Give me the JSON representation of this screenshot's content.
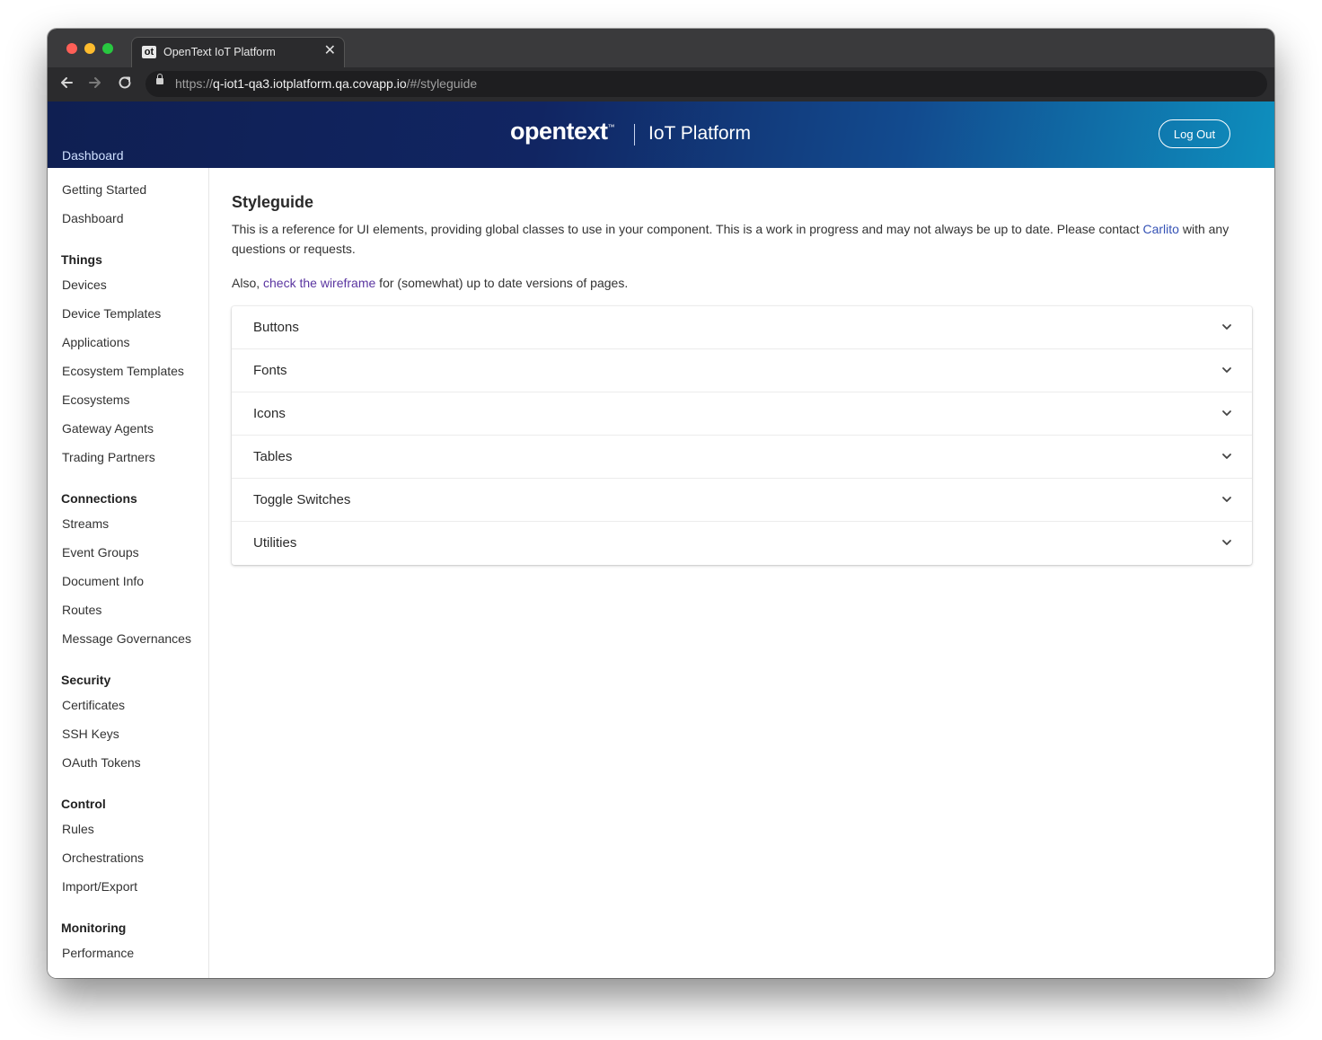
{
  "browser": {
    "tab_title": "OpenText IoT Platform",
    "tab_favicon": "ot",
    "tab_close": "✕",
    "url_scheme": "https://",
    "url_host": "q-iot1-qa3.iotplatform.qa.covapp.io",
    "url_path": "/#/styleguide",
    "icons": {
      "back": "arrow-left-icon",
      "forward": "arrow-right-icon",
      "reload": "reload-icon",
      "lock": "lock-icon"
    }
  },
  "header": {
    "dashboard_label": "Dashboard",
    "logo_text": "opentext",
    "logo_tm": "™",
    "platform_name": "IoT Platform",
    "logout_label": "Log Out"
  },
  "sidebar": {
    "top_items": [
      "Getting Started",
      "Dashboard"
    ],
    "sections": [
      {
        "title": "Things",
        "items": [
          "Devices",
          "Device Templates",
          "Applications",
          "Ecosystem Templates",
          "Ecosystems",
          "Gateway Agents",
          "Trading Partners"
        ]
      },
      {
        "title": "Connections",
        "items": [
          "Streams",
          "Event Groups",
          "Document Info",
          "Routes",
          "Message Governances"
        ]
      },
      {
        "title": "Security",
        "items": [
          "Certificates",
          "SSH Keys",
          "OAuth Tokens"
        ]
      },
      {
        "title": "Control",
        "items": [
          "Rules",
          "Orchestrations",
          "Import/Export"
        ]
      },
      {
        "title": "Monitoring",
        "items": [
          "Performance"
        ]
      }
    ]
  },
  "main": {
    "title": "Styleguide",
    "intro_before": "This is a reference for UI elements, providing global classes to use in your component. This is a work in progress and may not always be up to date. Please contact ",
    "intro_link": "Carlito",
    "intro_after": " with any questions or requests.",
    "also_before": "Also, ",
    "also_link": "check the wireframe",
    "also_after": " for (somewhat) up to date versions of pages.",
    "accordion": [
      "Buttons",
      "Fonts",
      "Icons",
      "Tables",
      "Toggle Switches",
      "Utilities"
    ]
  }
}
